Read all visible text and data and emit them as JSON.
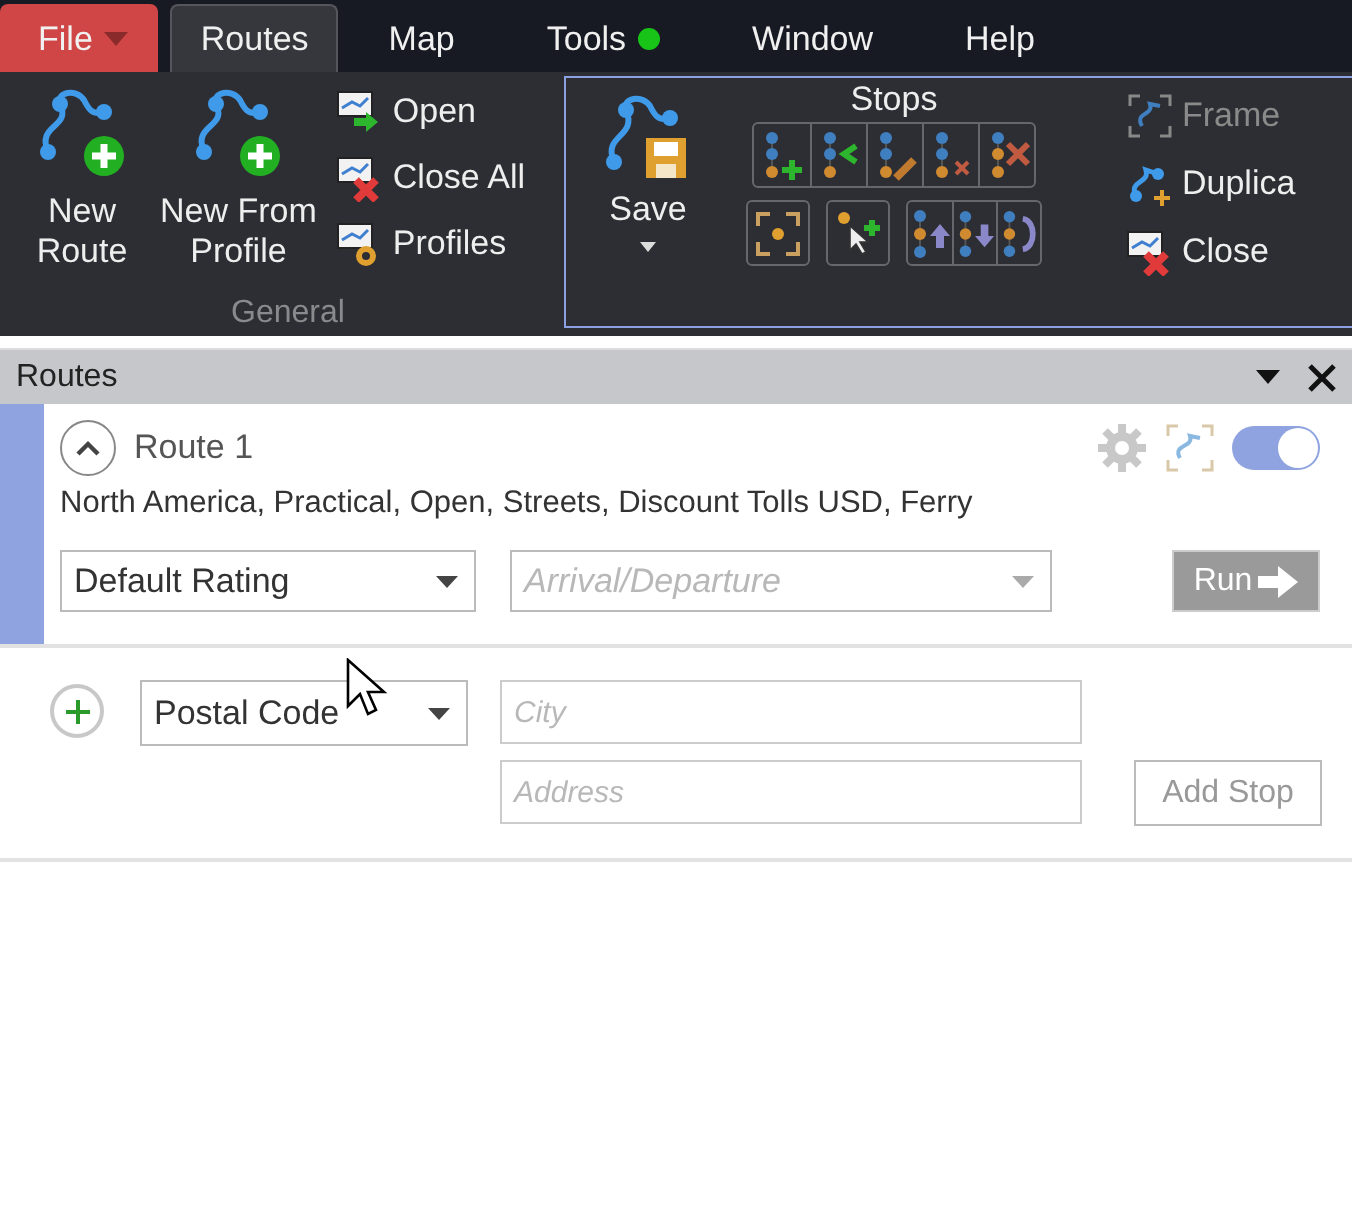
{
  "menu": [
    {
      "label": "File",
      "kind": "file",
      "selected": false,
      "indicator": false
    },
    {
      "label": "Routes",
      "kind": "tab",
      "selected": true,
      "indicator": false
    },
    {
      "label": "Map",
      "kind": "tab",
      "selected": false,
      "indicator": false
    },
    {
      "label": "Tools",
      "kind": "tab",
      "selected": false,
      "indicator": true
    },
    {
      "label": "Window",
      "kind": "tab",
      "selected": false,
      "indicator": false
    },
    {
      "label": "Help",
      "kind": "tab",
      "selected": false,
      "indicator": false
    }
  ],
  "ribbon": {
    "general": {
      "label": "General",
      "large_buttons": [
        {
          "lines": [
            "New",
            "Route"
          ]
        },
        {
          "lines": [
            "New From",
            "Profile"
          ]
        }
      ],
      "small_buttons": [
        {
          "label": "Open",
          "kind": "open"
        },
        {
          "label": "Close All",
          "kind": "close"
        },
        {
          "label": "Profiles",
          "kind": "profiles"
        }
      ]
    },
    "route_tools": {
      "save": {
        "label": "Save",
        "dropdown": true
      },
      "stops_title": "Stops",
      "side_buttons": [
        {
          "label": "Frame",
          "kind": "frame",
          "disabled": true
        },
        {
          "label": "Duplica",
          "kind": "duplicate",
          "disabled": false
        },
        {
          "label": "Close",
          "kind": "close",
          "disabled": false
        }
      ]
    }
  },
  "panel": {
    "title": "Routes",
    "route": {
      "name": "Route 1",
      "expanded": true,
      "visible": true,
      "options": "North America, Practical, Open, Streets, Discount Tolls USD, Ferry",
      "rating": "Default Rating",
      "timing_placeholder": "Arrival/Departure",
      "run": {
        "label": "Run",
        "disabled": true
      }
    },
    "stop_entry": {
      "type": "Postal Code",
      "city_placeholder": "City",
      "address_placeholder": "Address",
      "button": "Add Stop"
    }
  }
}
